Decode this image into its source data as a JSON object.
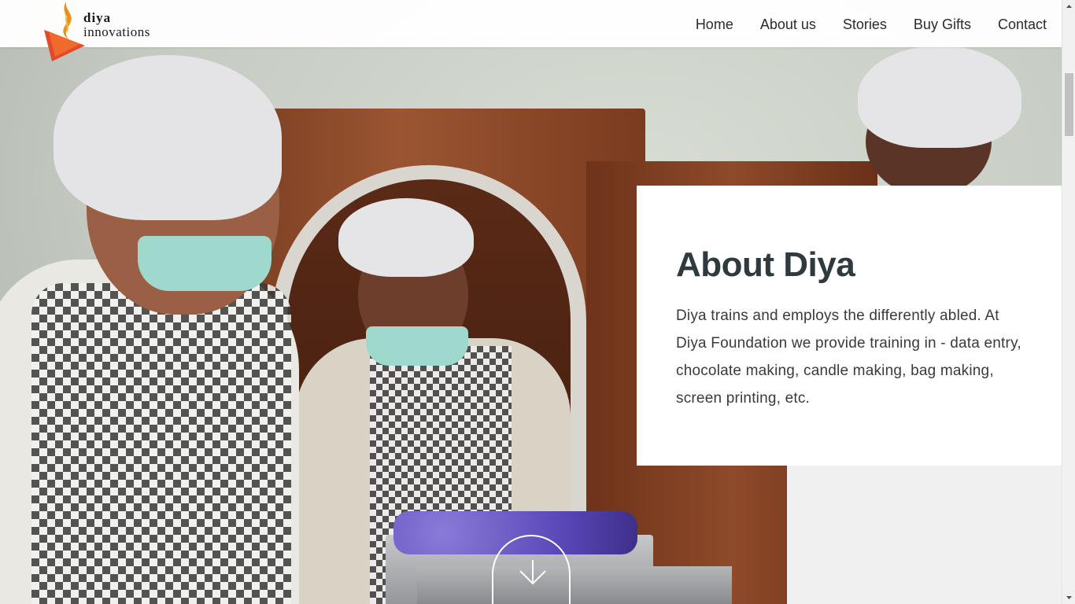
{
  "brand": {
    "line1": "diya",
    "line2": "innovations"
  },
  "nav": {
    "items": [
      {
        "label": "Home"
      },
      {
        "label": "About us"
      },
      {
        "label": "Stories"
      },
      {
        "label": "Buy Gifts"
      },
      {
        "label": "Contact"
      }
    ]
  },
  "about": {
    "title": "About Diya",
    "body": "Diya trains and employs the differently abled. At Diya Foundation we provide training in - data entry, chocolate making, candle making, bag making, screen printing, etc."
  },
  "icons": {
    "logo": "diya-flame-logo",
    "scroll": "chevron-down-icon"
  },
  "colors": {
    "heading": "#2f3a3f",
    "logo_orange": "#e8621e",
    "logo_red": "#d8382a"
  }
}
